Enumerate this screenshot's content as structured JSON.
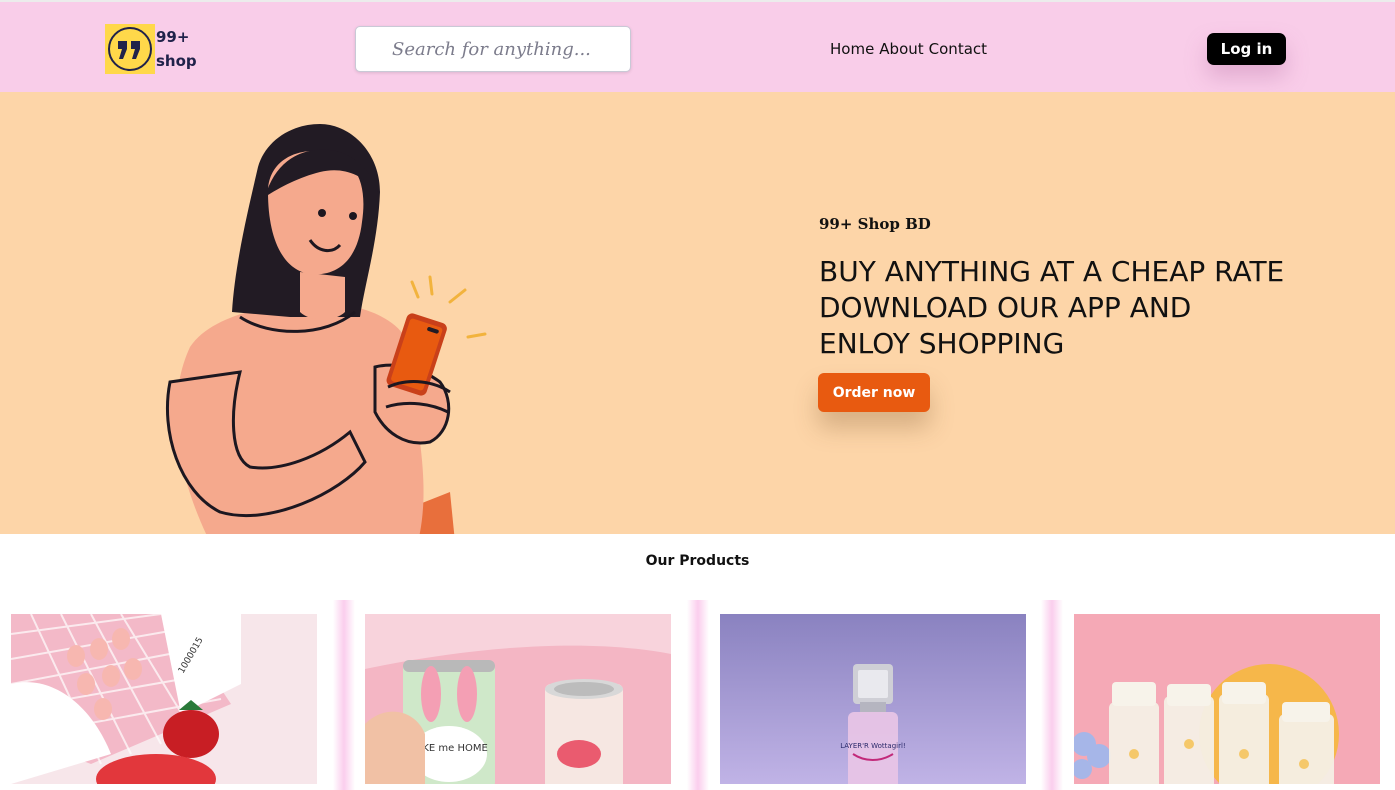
{
  "header": {
    "logo_line1": "99+",
    "logo_line2": "shop",
    "search_placeholder": "Search for anything...",
    "nav": [
      "Home",
      "About",
      "Contact"
    ],
    "login_label": "Log in"
  },
  "hero": {
    "subtitle": "99+ Shop BD",
    "title_lines": [
      "BUY ANYTHING AT A CHEAP RATE",
      "DOWNLOAD OUR APP AND",
      "ENLOY SHOPPING"
    ],
    "cta_label": "Order now"
  },
  "products": {
    "heading": "Our Products",
    "items": [
      {
        "name": "strawberry-lip-balm",
        "label": "1000015"
      },
      {
        "name": "take-me-home-can",
        "label": "TAKE me HOME"
      },
      {
        "name": "wottagirl-body-spray",
        "label": "LAYER'R Wottagirl!"
      },
      {
        "name": "daisy-bottles",
        "label": ""
      }
    ]
  },
  "colors": {
    "header_bg": "#f9cde9",
    "hero_bg": "#fdd5a8",
    "cta": "#e85a10",
    "login_bg": "#000000",
    "brand_text": "#20224a",
    "logo_yellow": "#ffd84a"
  }
}
